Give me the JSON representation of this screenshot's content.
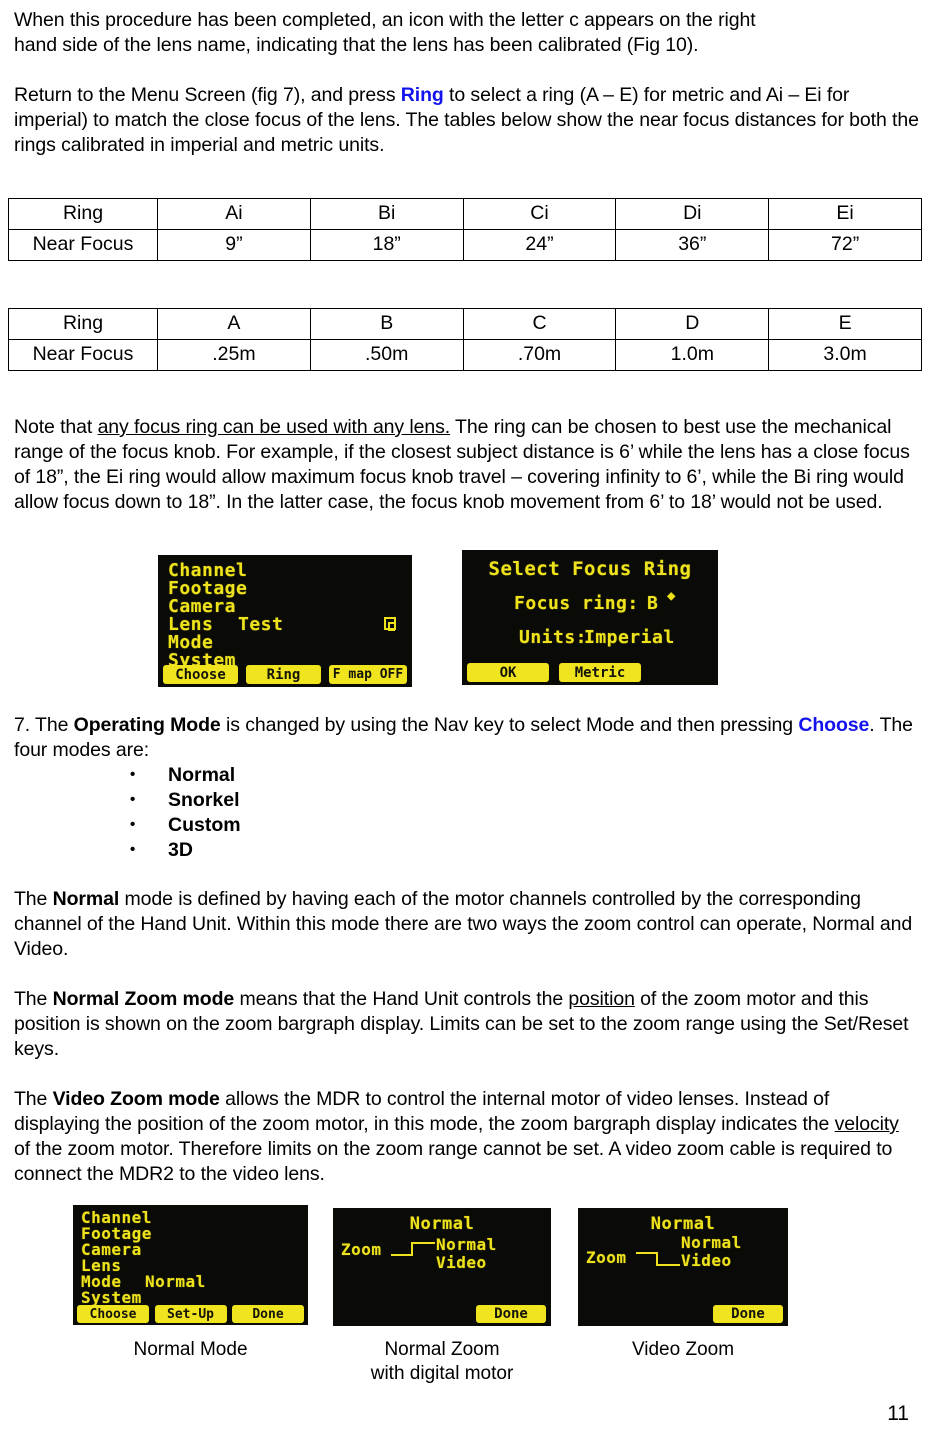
{
  "document": {
    "page_number": "11"
  },
  "paragraphs": {
    "p1_line1": "When this procedure has been completed, an icon with the letter c appears on the right",
    "p1_line2": "hand side of the lens name, indicating that the lens has been calibrated (Fig 10).",
    "p2_a": "Return to the Menu Screen (fig 7), and press ",
    "p2_link": "Ring",
    "p2_b": " to select a ring (A – E) for metric and Ai – Ei for imperial) to match the close focus of the lens. The tables below show the near focus distances for both the rings calibrated in imperial and metric units.",
    "note_a": "Note that ",
    "note_underlined": "any focus ring can be used with any lens.",
    "note_b": " The ring can be chosen to best use the mechanical range of the focus knob. For example, if the closest subject distance is 6’ while the lens has a close focus of 18”, the Ei ring would allow maximum focus knob travel – covering infinity to 6’, while the Bi ring would allow focus down to 18”. In the latter case, the focus knob movement from 6’ to 18’ would not be used.",
    "step7_num": "7. The ",
    "step7_bold": "Operating Mode",
    "step7_a": " is changed by using the Nav key to select Mode and then pressing ",
    "step7_link": "Choose",
    "step7_b": ". The four modes are:",
    "normal_a": "The ",
    "normal_bold": "Normal",
    "normal_b": " mode is defined by having each of the motor channels controlled by the corresponding channel of the Hand Unit. Within this mode there are two ways the zoom control can operate, Normal and Video.",
    "nzoom_a": "The ",
    "nzoom_bold": "Normal Zoom mode",
    "nzoom_b": " means that the Hand Unit controls the ",
    "nzoom_ul": "position",
    "nzoom_c": " of the zoom motor and this position is shown on the zoom bargraph display. Limits can be set to the zoom range using the Set/Reset keys.",
    "vzoom_a": "The ",
    "vzoom_bold": "Video Zoom mode",
    "vzoom_b": " allows the MDR to control the internal motor of video lenses. Instead of displaying the position of the zoom motor, in this mode, the zoom bargraph display indicates the ",
    "vzoom_ul": "velocity",
    "vzoom_c": " of the zoom motor. Therefore limits on the zoom range cannot be set. A video zoom cable is required to connect the MDR2 to the video lens."
  },
  "tables": {
    "imperial": {
      "header_label": "Ring",
      "row_label": "Near Focus",
      "rings": [
        "Ai",
        "Bi",
        "Ci",
        "Di",
        "Ei"
      ],
      "near_focus": [
        "9”",
        "18”",
        "24”",
        "36”",
        "72”"
      ]
    },
    "metric": {
      "header_label": "Ring",
      "row_label": "Near Focus",
      "rings": [
        "A",
        "B",
        "C",
        "D",
        "E"
      ],
      "near_focus": [
        ".25m",
        ".50m",
        ".70m",
        "1.0m",
        "3.0m"
      ]
    }
  },
  "modes_list": [
    "Normal",
    "Snorkel",
    "Custom",
    "3D"
  ],
  "lcd_screens": {
    "menu_lens": {
      "menu_items": [
        "Channel",
        "Footage",
        "Camera",
        "Lens",
        "Mode",
        "System"
      ],
      "lens_value": "Test",
      "cal_icon": "c-calibrated-icon",
      "buttons": [
        "Choose",
        "Ring",
        "F map OFF"
      ]
    },
    "select_focus_ring": {
      "title": "Select Focus Ring",
      "focus_ring_label": "Focus ring:",
      "focus_ring_value": "B",
      "spinner": "▲▼",
      "units_label": "Units:",
      "units_value": "Imperial",
      "buttons": [
        "OK",
        "Metric"
      ]
    },
    "menu_mode": {
      "menu_items": [
        "Channel",
        "Footage",
        "Camera",
        "Lens",
        "Mode",
        "System"
      ],
      "mode_value": "Normal",
      "buttons": [
        "Choose",
        "Set-Up",
        "Done"
      ]
    },
    "normal_zoom": {
      "title": "Normal",
      "left_label": "Zoom",
      "options": [
        "Normal",
        "Video"
      ],
      "selected": "Normal",
      "buttons": [
        "Done"
      ]
    },
    "video_zoom": {
      "title": "Normal",
      "left_label": "Zoom",
      "options": [
        "Normal",
        "Video"
      ],
      "selected": "Video",
      "buttons": [
        "Done"
      ]
    }
  },
  "captions": {
    "c1": "Normal Mode",
    "c2_line1": "Normal Zoom",
    "c2_line2": "with digital motor",
    "c3": "Video Zoom"
  },
  "colors": {
    "link": "#1313ee",
    "lcd_bg": "#0a0a06",
    "lcd_fg": "#ede21c"
  }
}
